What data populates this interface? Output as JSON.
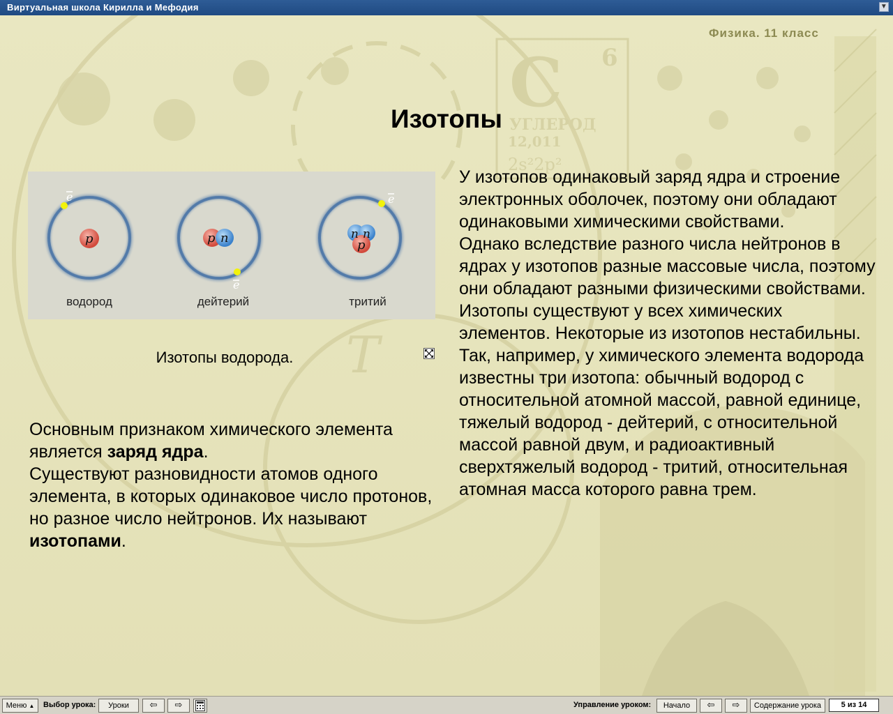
{
  "window": {
    "title": "Виртуальная школа Кирилла и Мефодия"
  },
  "subject": "Физика. 11 класс",
  "page_title": "Изотопы",
  "figure": {
    "atoms": [
      {
        "label": "водород",
        "nucleus": [
          "p"
        ]
      },
      {
        "label": "дейтерий",
        "nucleus": [
          "p",
          "n"
        ]
      },
      {
        "label": "тритий",
        "nucleus": [
          "n",
          "n",
          "p"
        ]
      }
    ],
    "electron_symbol": "e",
    "proton_symbol": "p",
    "neutron_symbol": "n",
    "caption": "Изотопы водорода.",
    "colors": {
      "proton": "#d9564a",
      "neutron": "#4a8fd4",
      "electron": "#f2f20a",
      "orbit": "#4f78a8"
    }
  },
  "left_text": {
    "p1_before": "Основным признаком химического элемента является ",
    "p1_bold": "заряд ядра",
    "p1_after": ".",
    "p2_before": "Существуют разновидности атомов одного элемента, в которых одинаковое число протонов, но разное число нейтронов. Их называют ",
    "p2_bold": "изотопами",
    "p2_after": "."
  },
  "right_text": {
    "p1": "У изотопов одинаковый заряд ядра и строение электронных оболочек, поэтому они обладают одинаковыми химическими свойствами.",
    "p2": "Однако вследствие разного числа нейтронов в ядрах у изотопов разные массовые числа, поэтому они обладают разными физическими свойствами. Изотопы существуют у всех химических элементов. Некоторые из изотопов нестабильны.",
    "p3": "Так, например, у химического элемента водорода известны три изотопа: обычный водород с относительной атомной массой, равной единице, тяжелый водород - дейтерий, с относительной массой равной двум, и радиоактивный сверхтяжелый водород - тритий, относительная атомная масса которого равна трем."
  },
  "background": {
    "element_symbol": "C",
    "element_number": "6",
    "element_name": "УГЛЕРОД",
    "element_mass": "12,011",
    "config": "2s²2p²",
    "t_symbol": "T"
  },
  "toolbar": {
    "menu": "Меню",
    "lesson_choice_label": "Выбор урока:",
    "lessons_button": "Уроки",
    "lesson_control_label": "Управление уроком:",
    "start_button": "Начало",
    "contents_button": "Содержание урока",
    "page_info": "5 из 14"
  }
}
